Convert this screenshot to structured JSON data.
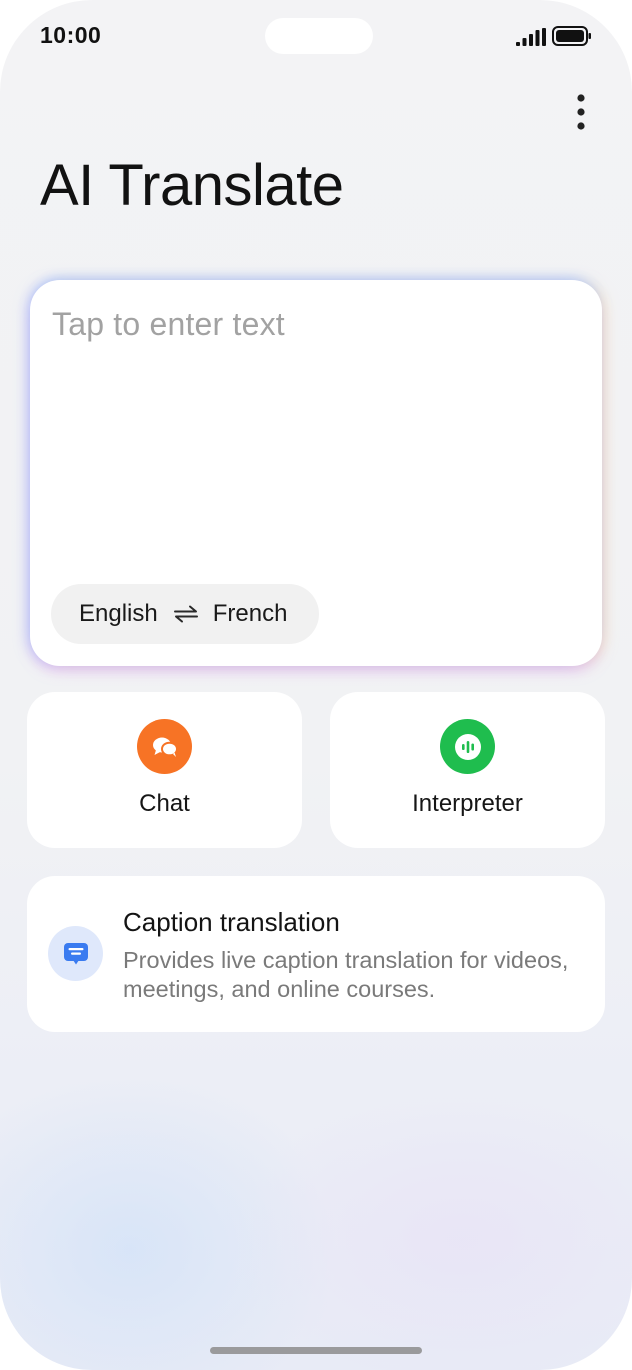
{
  "status_bar": {
    "time": "10:00",
    "signal_icon": "cellular-signal-icon",
    "battery_icon": "battery-icon"
  },
  "header": {
    "title": "AI Translate",
    "menu_icon": "more-vertical-icon"
  },
  "input": {
    "placeholder": "Tap to enter text",
    "source_language": "English",
    "target_language": "French",
    "swap_icon": "swap-arrows-icon"
  },
  "features": [
    {
      "label": "Chat",
      "icon": "chat-bubbles-icon",
      "color": "#f77325"
    },
    {
      "label": "Interpreter",
      "icon": "audio-wave-icon",
      "color": "#1fbd4e"
    }
  ],
  "caption": {
    "title": "Caption translation",
    "description": "Provides live caption translation for videos, meetings, and online courses.",
    "icon": "subtitles-icon",
    "icon_color": "#3a7bf0"
  }
}
